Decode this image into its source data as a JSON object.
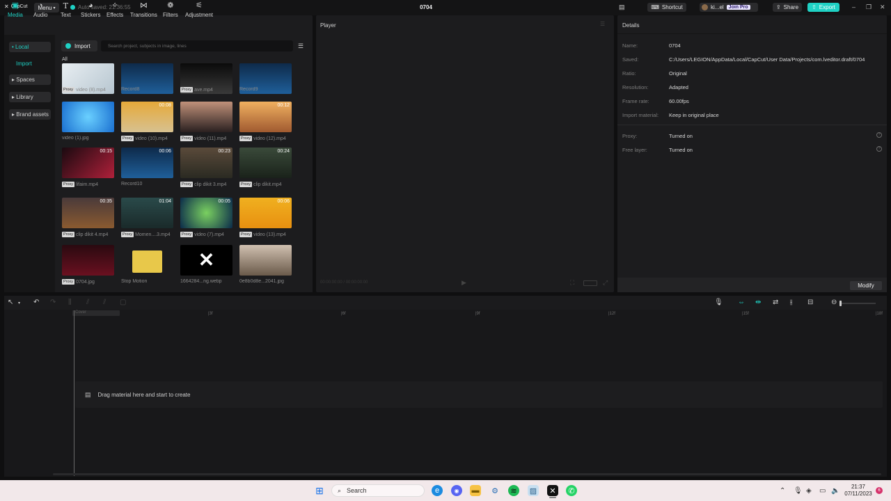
{
  "app": {
    "logo_text": "CapCut",
    "menu_label": "Menu",
    "autosave_text": "Auto saved: 21:36:55",
    "project_title": "0704",
    "shortcut_label": "Shortcut",
    "user_label": "ki...el",
    "join_pro_label": "Join Pro",
    "share_label": "Share",
    "export_label": "Export",
    "accent_color": "#1fd1c4"
  },
  "tabs": [
    {
      "label": "Media",
      "icon": "media-icon",
      "active": true
    },
    {
      "label": "Audio",
      "icon": "audio-icon"
    },
    {
      "label": "Text",
      "icon": "text-icon"
    },
    {
      "label": "Stickers",
      "icon": "stickers-icon"
    },
    {
      "label": "Effects",
      "icon": "effects-icon"
    },
    {
      "label": "Transitions",
      "icon": "transitions-icon"
    },
    {
      "label": "Filters",
      "icon": "filters-icon"
    },
    {
      "label": "Adjustment",
      "icon": "adjustment-icon"
    }
  ],
  "sidebar": {
    "items": [
      {
        "label": "• Local"
      },
      {
        "label": "Import"
      },
      {
        "label": "▸ Spaces"
      },
      {
        "label": "▸ Library"
      },
      {
        "label": "▸ Brand assets"
      }
    ]
  },
  "media": {
    "import_label": "Import",
    "search_placeholder": "Search project, subjects in image, lines",
    "all_label": "All",
    "proxy_label": "Proxy",
    "items": [
      {
        "name": "video (8).mp4",
        "proxy": true,
        "duration": ""
      },
      {
        "name": "Record8",
        "proxy": false,
        "duration": ""
      },
      {
        "name": "ave.mp4",
        "proxy": true,
        "duration": ""
      },
      {
        "name": "Record9",
        "proxy": false,
        "duration": ""
      },
      {
        "name": "video (1).jpg",
        "proxy": false,
        "duration": ""
      },
      {
        "name": "video (10).mp4",
        "proxy": true,
        "duration": "00:08"
      },
      {
        "name": "video (11).mp4",
        "proxy": true,
        "duration": ""
      },
      {
        "name": "video (12).mp4",
        "proxy": true,
        "duration": "00:12"
      },
      {
        "name": "lifaim.mp4",
        "proxy": true,
        "duration": "00:15"
      },
      {
        "name": "Record10",
        "proxy": false,
        "duration": "00:06"
      },
      {
        "name": "clip dikit 3.mp4",
        "proxy": true,
        "duration": "00:23"
      },
      {
        "name": "clip dikit.mp4",
        "proxy": true,
        "duration": "00:24"
      },
      {
        "name": "clip dikit 4.mp4",
        "proxy": true,
        "duration": "00:35"
      },
      {
        "name": "Momen....3.mp4",
        "proxy": true,
        "duration": "01:04"
      },
      {
        "name": "video (7).mp4",
        "proxy": true,
        "duration": "00:05"
      },
      {
        "name": "video (13).mp4",
        "proxy": true,
        "duration": "00:06"
      },
      {
        "name": "0704.jpg",
        "proxy": true,
        "duration": ""
      },
      {
        "name": "Stop Motion",
        "proxy": false,
        "duration": ""
      },
      {
        "name": "1664284...ng.webp",
        "proxy": false,
        "duration": ""
      },
      {
        "name": "0e8b0d8e...2041.jpg",
        "proxy": false,
        "duration": ""
      }
    ]
  },
  "player": {
    "title": "Player",
    "timecode": "00:00:00:00 / 00:00:00:00"
  },
  "details": {
    "title": "Details",
    "rows": [
      {
        "label": "Name:",
        "value": "0704"
      },
      {
        "label": "Saved:",
        "value": "C:/Users/LEGION/AppData/Local/CapCut/User Data/Projects/com.lveditor.draft/0704"
      },
      {
        "label": "Ratio:",
        "value": "Original"
      },
      {
        "label": "Resolution:",
        "value": "Adapted"
      },
      {
        "label": "Frame rate:",
        "value": "60.00fps"
      },
      {
        "label": "Import material:",
        "value": "Keep in original place"
      },
      {
        "label": "Proxy:",
        "value": "Turned on"
      },
      {
        "label": "Free layer:",
        "value": "Turned on"
      }
    ],
    "modify_label": "Modify"
  },
  "timeline": {
    "cover_label": "Cover",
    "ruler": [
      "00:00",
      "|3f",
      "|6f",
      "|9f",
      "|12f",
      "|15f",
      "|18f"
    ],
    "drop_text": "Drag material here and start to create"
  },
  "taskbar": {
    "search_label": "Search",
    "time": "21:37",
    "date": "07/11/2023",
    "notification_count": "6"
  }
}
